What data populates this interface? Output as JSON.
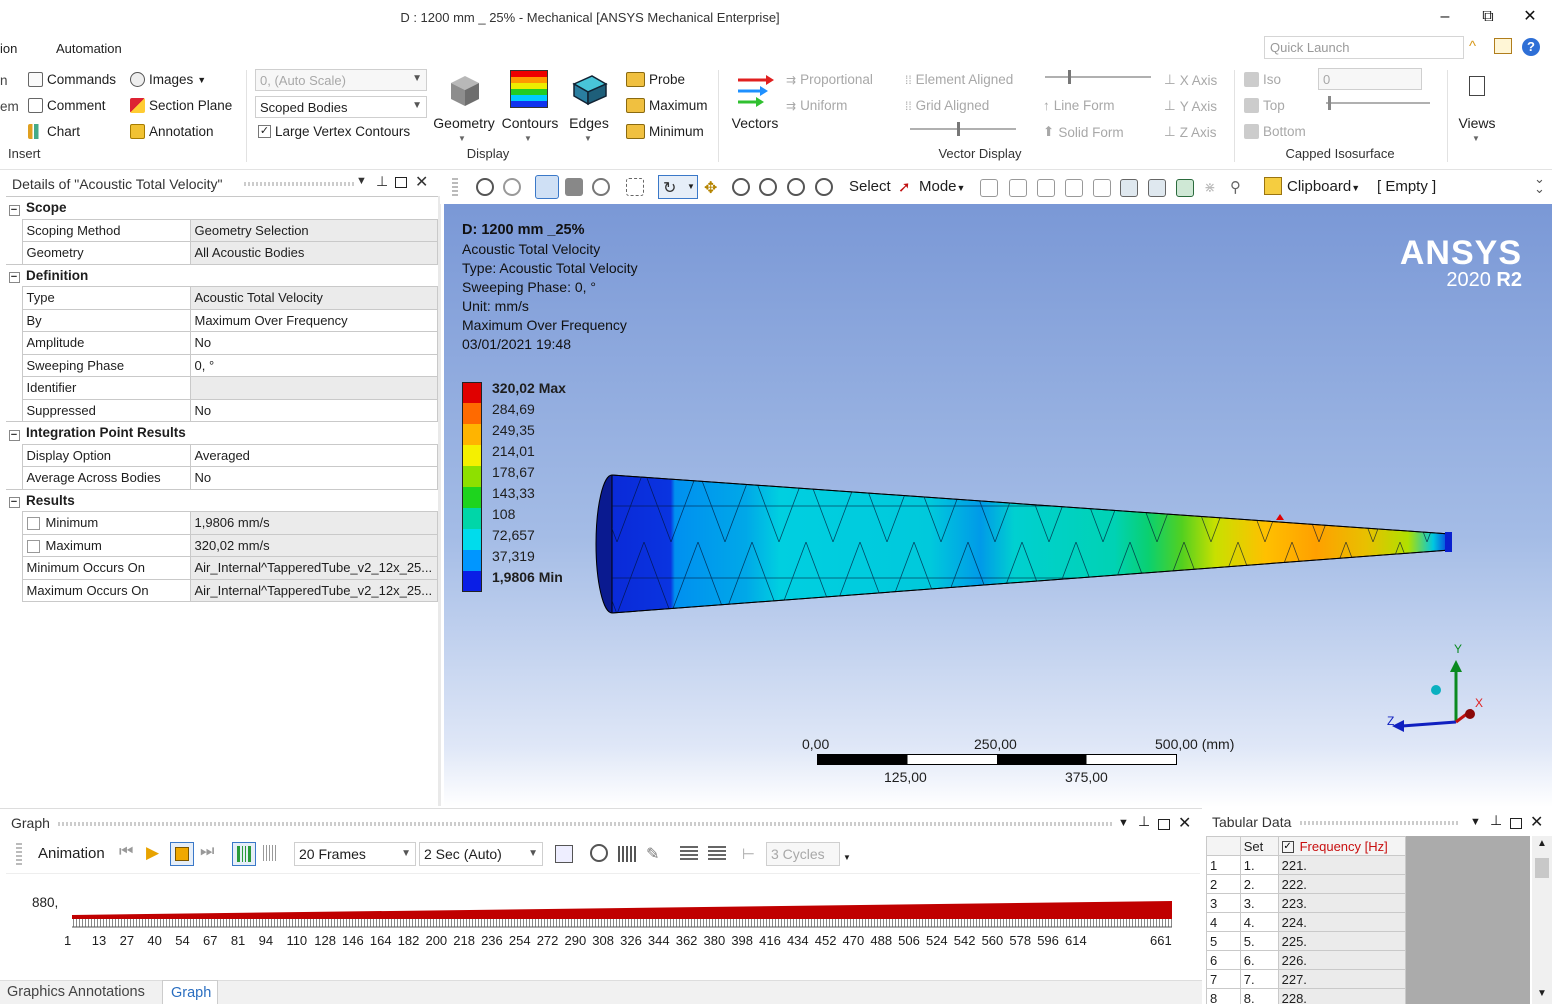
{
  "window": {
    "title": "D : 1200 mm _ 25% - Mechanical [ANSYS Mechanical Enterprise]",
    "minimize": "–",
    "restore": "⧉",
    "close": "✕"
  },
  "menu": {
    "items": [
      "ion",
      "Automation"
    ],
    "quick_launch_placeholder": "Quick Launch"
  },
  "ribbon": {
    "insert": {
      "items": [
        "Commands",
        "Images",
        "Section Plane",
        "Comment",
        "Chart",
        "Annotation"
      ],
      "cut_left": [
        "n",
        "em"
      ],
      "label": "Insert"
    },
    "display": {
      "scale_combo": "0, (Auto Scale)",
      "scope_combo": "Scoped Bodies",
      "large_vertex_label": "Large Vertex Contours",
      "large_vertex_checked": true,
      "geometry": "Geometry",
      "contours": "Contours",
      "edges": "Edges",
      "probe": "Probe",
      "maximum": "Maximum",
      "minimum": "Minimum",
      "label": "Display"
    },
    "vector_display": {
      "vectors": "Vectors",
      "proportional": "Proportional",
      "uniform": "Uniform",
      "element_aligned": "Element Aligned",
      "grid_aligned": "Grid Aligned",
      "line_form": "Line Form",
      "solid_form": "Solid Form",
      "x_axis": "X Axis",
      "y_axis": "Y Axis",
      "z_axis": "Z Axis",
      "label": "Vector Display"
    },
    "capped": {
      "iso": "Iso",
      "top": "Top",
      "bottom": "Bottom",
      "value": "0",
      "label": "Capped Isosurface"
    },
    "views": "Views"
  },
  "details": {
    "title": "Details of \"Acoustic Total Velocity\"",
    "sections": [
      {
        "name": "Scope",
        "rows": [
          {
            "key": "Scoping Method",
            "value": "Geometry Selection",
            "grey": true
          },
          {
            "key": "Geometry",
            "value": "All Acoustic Bodies",
            "grey": true
          }
        ]
      },
      {
        "name": "Definition",
        "rows": [
          {
            "key": "Type",
            "value": "Acoustic Total Velocity",
            "grey": true
          },
          {
            "key": "By",
            "value": "Maximum Over Frequency",
            "grey": false
          },
          {
            "key": "Amplitude",
            "value": "No",
            "grey": false
          },
          {
            "key": "Sweeping Phase",
            "value": "0, °",
            "grey": false
          },
          {
            "key": "Identifier",
            "value": "",
            "grey": true
          },
          {
            "key": "Suppressed",
            "value": "No",
            "grey": false
          }
        ]
      },
      {
        "name": "Integration Point Results",
        "rows": [
          {
            "key": "Display Option",
            "value": "Averaged",
            "grey": false
          },
          {
            "key": "Average Across Bodies",
            "value": "No",
            "grey": false
          }
        ]
      },
      {
        "name": "Results",
        "rows": [
          {
            "key": "Minimum",
            "value": "1,9806 mm/s",
            "grey": true,
            "check": true
          },
          {
            "key": "Maximum",
            "value": "320,02 mm/s",
            "grey": true,
            "check": true
          },
          {
            "key": "Minimum Occurs On",
            "value": "Air_Internal^TapperedTube_v2_12x_25...",
            "grey": true
          },
          {
            "key": "Maximum Occurs On",
            "value": "Air_Internal^TapperedTube_v2_12x_25...",
            "grey": true
          }
        ]
      }
    ]
  },
  "graphics_toolbar": {
    "select": "Select",
    "mode": "Mode",
    "clipboard": "Clipboard",
    "empty": "[ Empty ]"
  },
  "viewport": {
    "info_title": "D: 1200 mm _25%",
    "info_lines": [
      "Acoustic Total Velocity",
      "Type: Acoustic Total Velocity",
      "Sweeping Phase: 0, °",
      "Unit: mm/s",
      "Maximum Over Frequency",
      "03/01/2021 19:48"
    ],
    "legend": [
      {
        "label": "320,02 Max",
        "color": "#e00000",
        "bold": true
      },
      {
        "label": "284,69",
        "color": "#ff6a00",
        "bold": false
      },
      {
        "label": "249,35",
        "color": "#ffb400",
        "bold": false
      },
      {
        "label": "214,01",
        "color": "#f5f000",
        "bold": false
      },
      {
        "label": "178,67",
        "color": "#8ee000",
        "bold": false
      },
      {
        "label": "143,33",
        "color": "#1ed41e",
        "bold": false
      },
      {
        "label": "108",
        "color": "#00d6a8",
        "bold": false
      },
      {
        "label": "72,657",
        "color": "#00dcec",
        "bold": false
      },
      {
        "label": "37,319",
        "color": "#0096ff",
        "bold": false
      },
      {
        "label": "1,9806 Min",
        "color": "#0a1ee6",
        "bold": true
      }
    ],
    "logo_main": "ANSYS",
    "logo_version": "2020",
    "logo_release": "R2",
    "scale_top": [
      "0,00",
      "250,00",
      "500,00 (mm)"
    ],
    "scale_bottom": [
      "125,00",
      "375,00"
    ],
    "axis_x": "X",
    "axis_y": "Y",
    "axis_z": "Z"
  },
  "graph": {
    "title": "Graph",
    "animation": "Animation",
    "frames": "20 Frames",
    "duration": "2 Sec (Auto)",
    "cycles": "3 Cycles",
    "y_label": "880,",
    "x_ticks": [
      "1",
      "13",
      "27",
      "40",
      "54",
      "67",
      "81",
      "94",
      "110",
      "128",
      "146",
      "164",
      "182",
      "200",
      "218",
      "236",
      "254",
      "272",
      "290",
      "308",
      "326",
      "344",
      "362",
      "380",
      "398",
      "416",
      "434",
      "452",
      "470",
      "488",
      "506",
      "524",
      "542",
      "560",
      "578",
      "596",
      "614",
      "661"
    ]
  },
  "bottom_tabs": [
    "Graphics Annotations",
    "Graph"
  ],
  "tabular": {
    "title": "Tabular Data",
    "col_set": "Set",
    "col_freq": "Frequency [Hz]",
    "rows": [
      {
        "n": "1",
        "set": "1.",
        "freq": "221."
      },
      {
        "n": "2",
        "set": "2.",
        "freq": "222."
      },
      {
        "n": "3",
        "set": "3.",
        "freq": "223."
      },
      {
        "n": "4",
        "set": "4.",
        "freq": "224."
      },
      {
        "n": "5",
        "set": "5.",
        "freq": "225."
      },
      {
        "n": "6",
        "set": "6.",
        "freq": "226."
      },
      {
        "n": "7",
        "set": "7.",
        "freq": "227."
      },
      {
        "n": "8",
        "set": "8.",
        "freq": "228."
      }
    ]
  }
}
